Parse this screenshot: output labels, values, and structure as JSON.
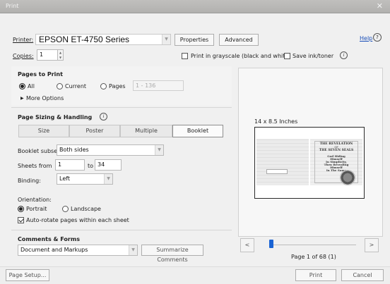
{
  "window": {
    "title": "Print",
    "close_glyph": "✕"
  },
  "printer": {
    "label": "Printer:",
    "value": "EPSON ET-4750 Series",
    "properties_label": "Properties",
    "advanced_label": "Advanced",
    "help_label": "Help",
    "help_glyph": "?"
  },
  "copies": {
    "label": "Copies:",
    "value": "1"
  },
  "options": {
    "grayscale_label": "Print in grayscale (black and white)",
    "grayscale_checked": false,
    "save_ink_label": "Save ink/toner",
    "save_ink_checked": false,
    "info_glyph": "i"
  },
  "pages_to_print": {
    "heading": "Pages to Print",
    "all_label": "All",
    "current_label": "Current",
    "pages_label": "Pages",
    "pages_value": "1 - 136",
    "selected": "all",
    "more_options_label": "More Options"
  },
  "sizing": {
    "heading": "Page Sizing & Handling",
    "tabs": [
      "Size",
      "Poster",
      "Multiple",
      "Booklet"
    ],
    "active_tab": "Booklet",
    "booklet_subset_label": "Booklet subset:",
    "booklet_subset_value": "Both sides",
    "sheets_from_label": "Sheets from",
    "sheets_from_value": "1",
    "sheets_to_label": "to",
    "sheets_to_value": "34",
    "binding_label": "Binding:",
    "binding_value": "Left"
  },
  "orientation": {
    "heading": "Orientation:",
    "portrait_label": "Portrait",
    "landscape_label": "Landscape",
    "selected": "portrait",
    "autorotate_label": "Auto-rotate pages within each sheet",
    "autorotate_checked": true
  },
  "comments": {
    "heading": "Comments & Forms",
    "value": "Document and Markups",
    "summarize_label": "Summarize Comments"
  },
  "preview": {
    "size_text": "14 x 8.5 Inches",
    "cover_lines": [
      "THE REVELATION",
      "OF",
      "THE SEVEN SEALS",
      "God Hiding",
      "Himself",
      "In Simplicity,",
      "Then Revealing",
      "Himself",
      "In The Same"
    ],
    "page_info": "Page 1 of 68 (1)",
    "prev_glyph": "<",
    "next_glyph": ">"
  },
  "footer": {
    "page_setup_label": "Page Setup...",
    "print_label": "Print",
    "cancel_label": "Cancel"
  },
  "colors": {
    "accent": "#1a63d4",
    "titlebar": "#b8b7b5"
  }
}
